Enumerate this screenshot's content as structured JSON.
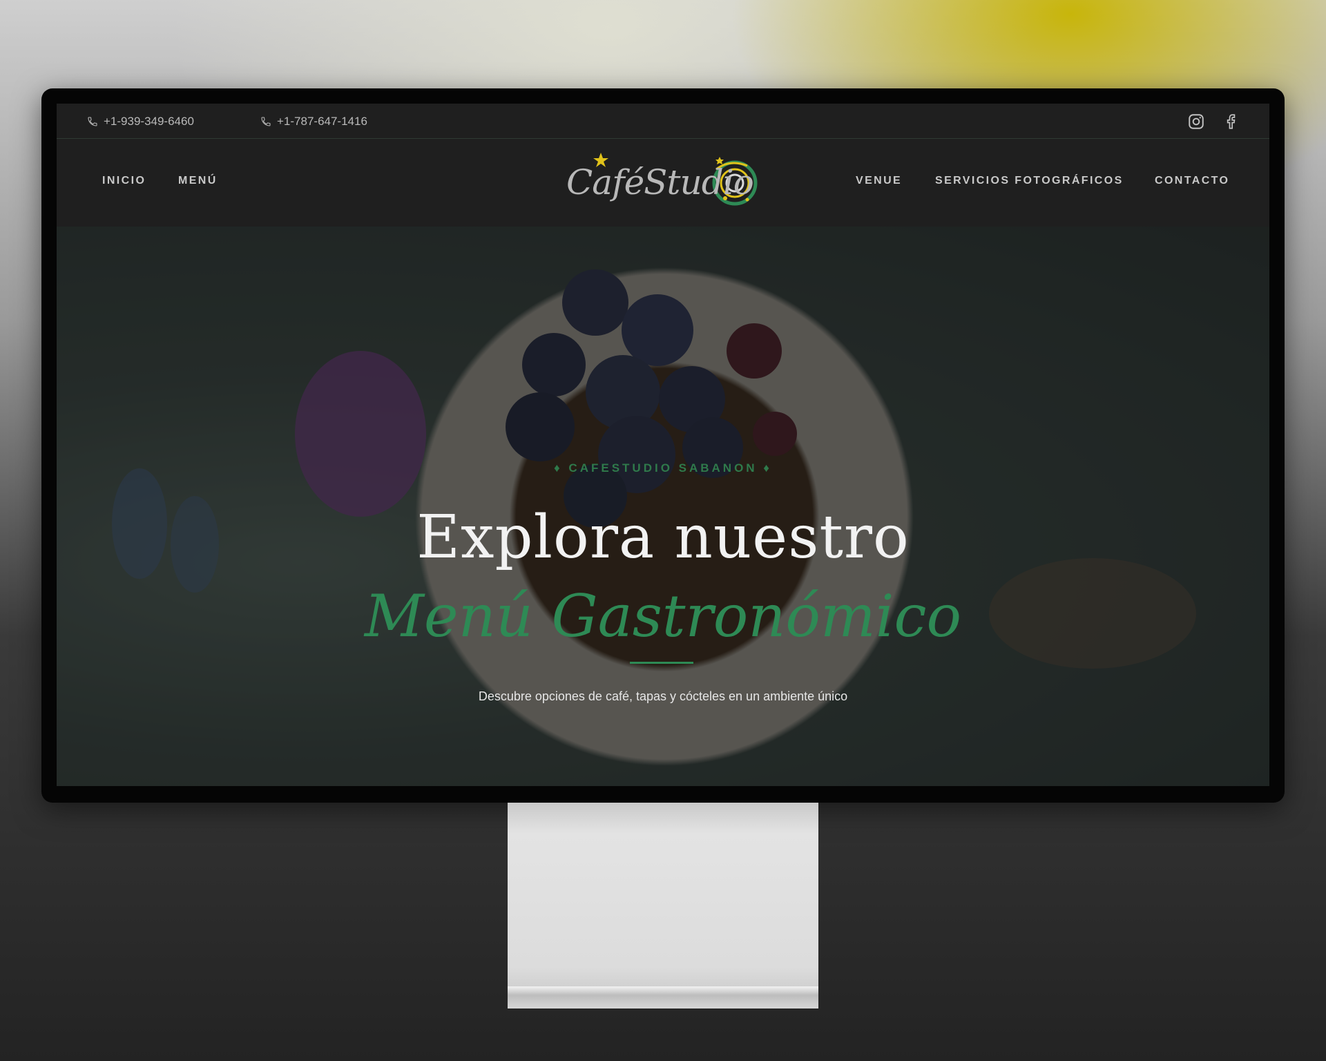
{
  "topbar": {
    "phones": [
      "+1-939-349-6460",
      "+1-787-647-1416"
    ],
    "social": [
      {
        "icon": "instagram-icon"
      },
      {
        "icon": "facebook-icon"
      }
    ]
  },
  "nav": {
    "left": [
      "INICIO",
      "MENÚ"
    ],
    "right": [
      "VENUE",
      "SERVICIOS FOTOGRÁFICOS",
      "CONTACTO"
    ],
    "logo_text": "CaféStudio"
  },
  "hero": {
    "eyebrow": "♦ CAFESTUDIO SABANON ♦",
    "title": "Explora nuestro",
    "title_accent": "Menú Gastronómico",
    "subtitle": "Descubre opciones de café, tapas y cócteles en un ambiente único"
  },
  "colors": {
    "accent_green": "#2e8a55",
    "nav_bg": "#1f1f1f",
    "logo_yellow": "#e0c21a"
  }
}
